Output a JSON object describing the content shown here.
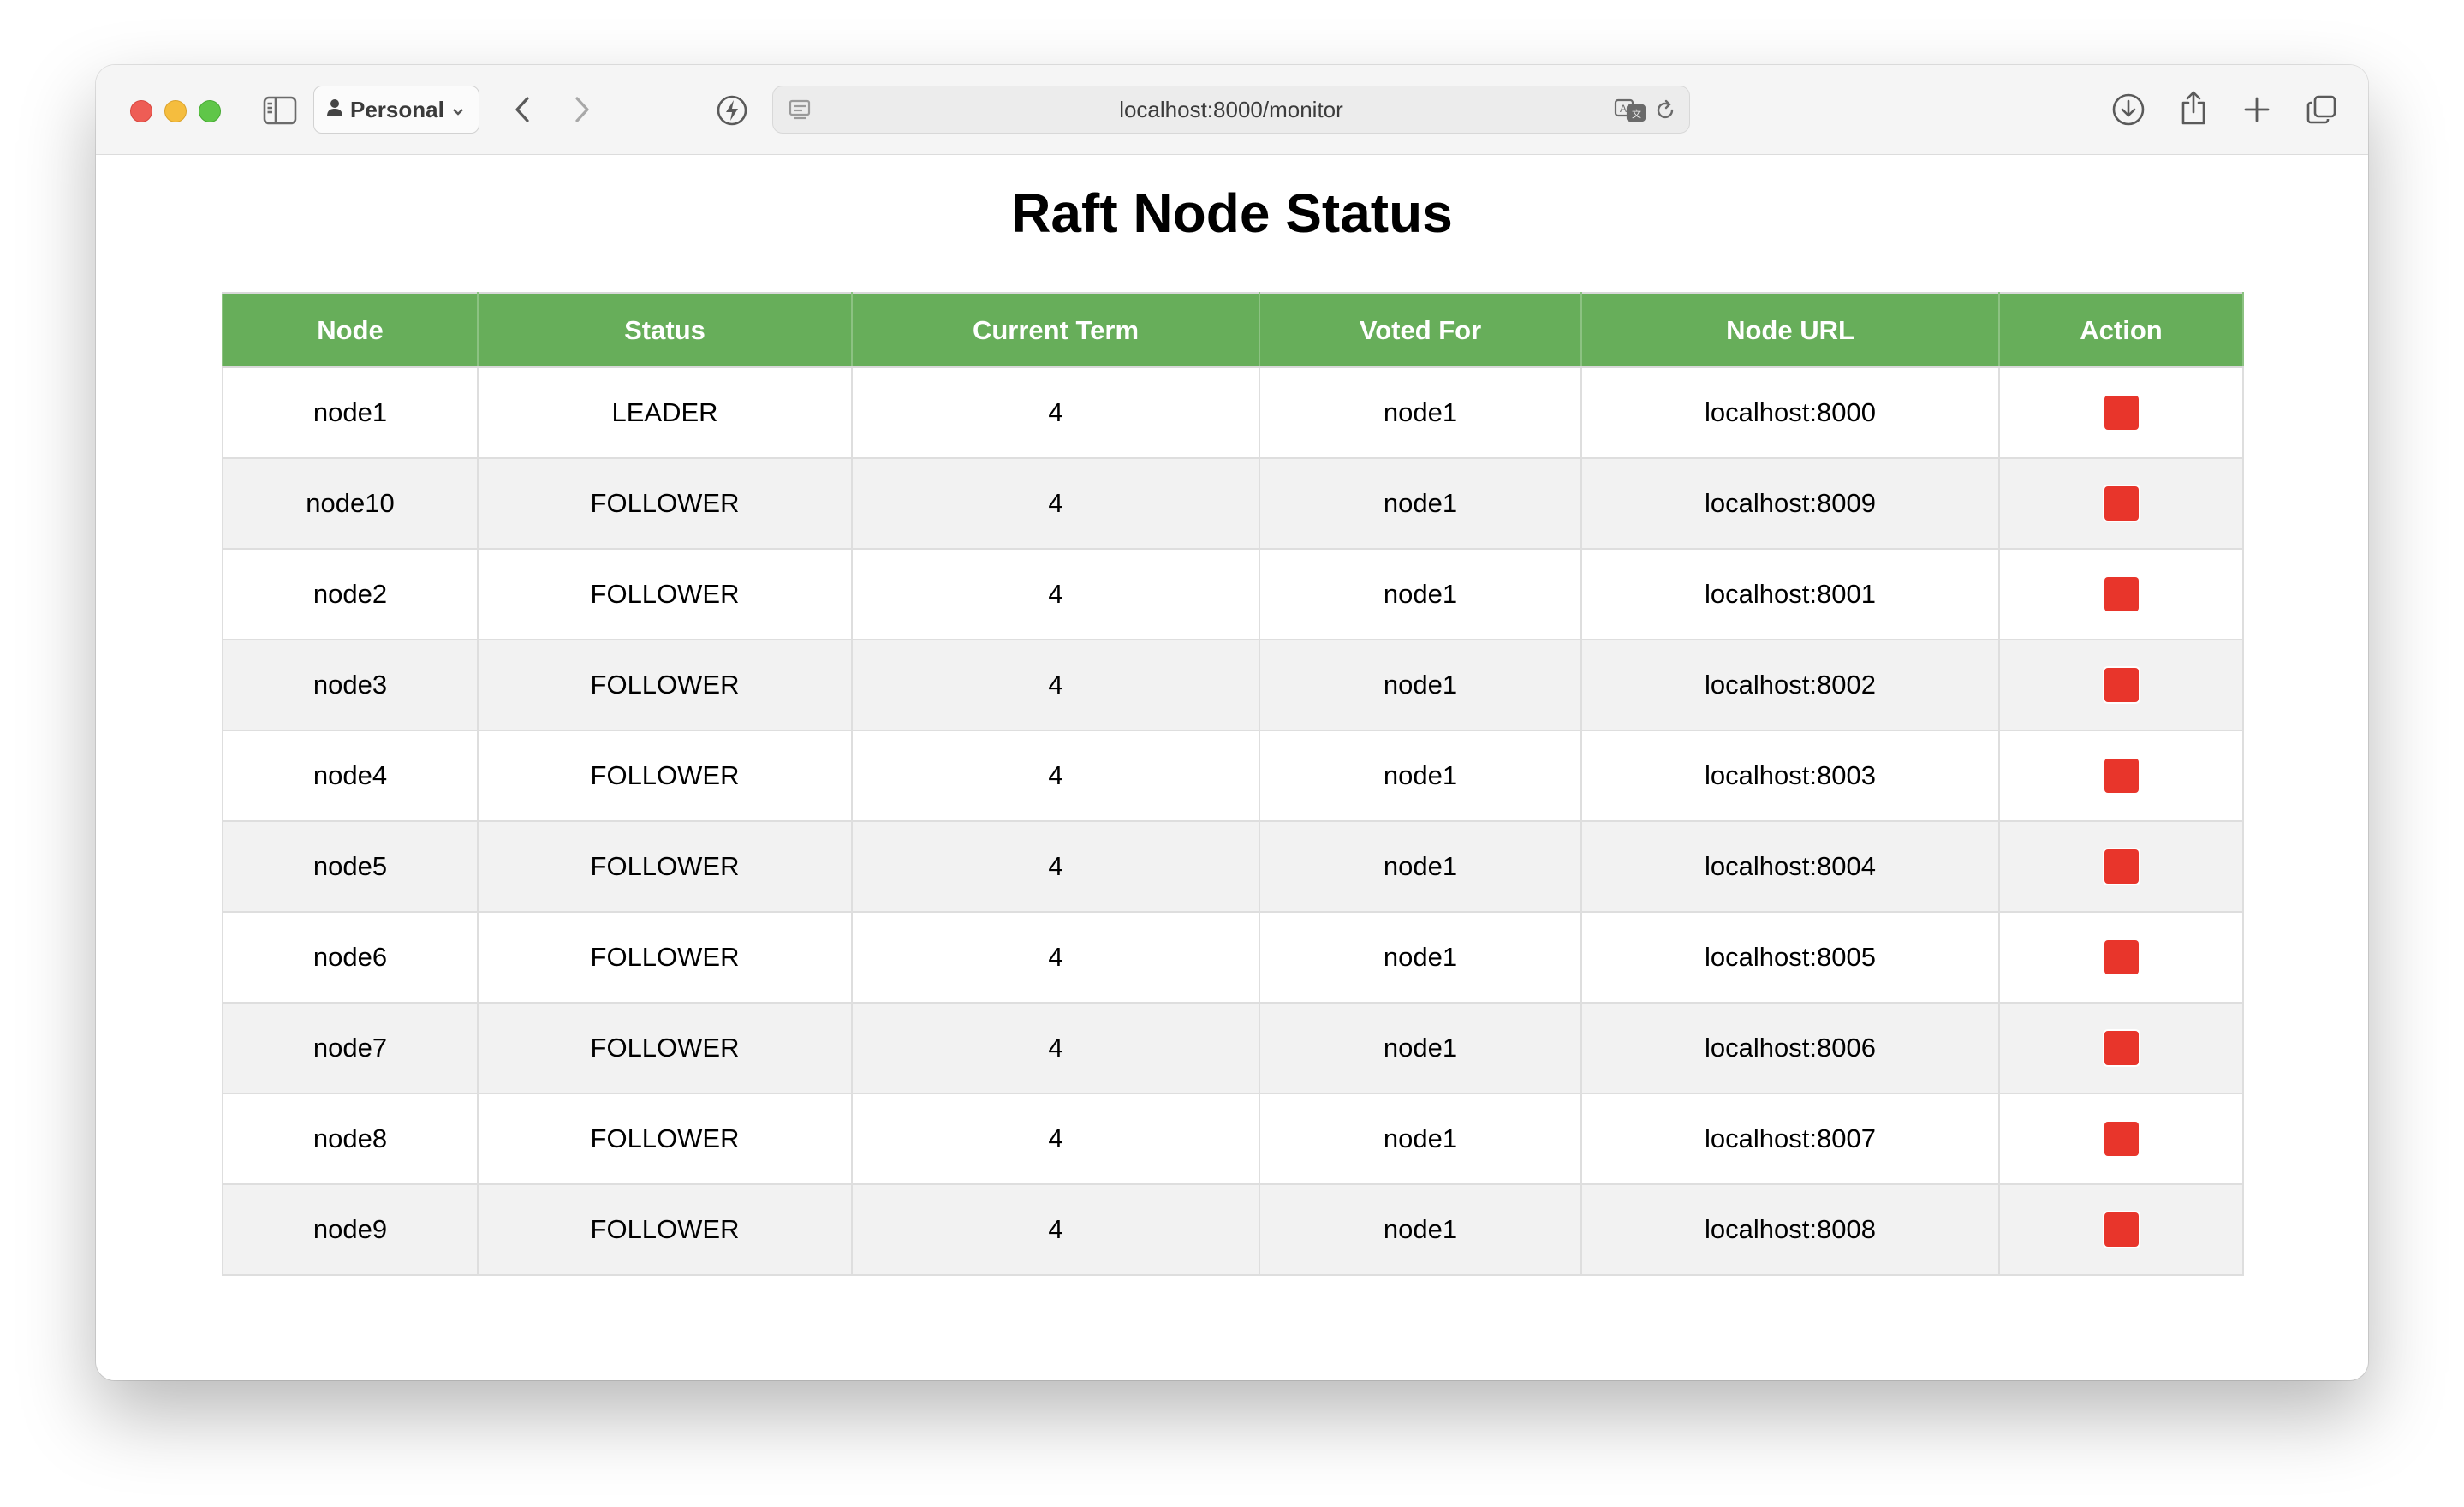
{
  "browser": {
    "profile_label": "Personal",
    "url": "localhost:8000/monitor"
  },
  "page": {
    "title": "Raft Node Status"
  },
  "table": {
    "headers": [
      "Node",
      "Status",
      "Current Term",
      "Voted For",
      "Node URL",
      "Action"
    ],
    "rows": [
      {
        "node": "node1",
        "status": "LEADER",
        "term": "4",
        "voted_for": "node1",
        "url": "localhost:8000"
      },
      {
        "node": "node10",
        "status": "FOLLOWER",
        "term": "4",
        "voted_for": "node1",
        "url": "localhost:8009"
      },
      {
        "node": "node2",
        "status": "FOLLOWER",
        "term": "4",
        "voted_for": "node1",
        "url": "localhost:8001"
      },
      {
        "node": "node3",
        "status": "FOLLOWER",
        "term": "4",
        "voted_for": "node1",
        "url": "localhost:8002"
      },
      {
        "node": "node4",
        "status": "FOLLOWER",
        "term": "4",
        "voted_for": "node1",
        "url": "localhost:8003"
      },
      {
        "node": "node5",
        "status": "FOLLOWER",
        "term": "4",
        "voted_for": "node1",
        "url": "localhost:8004"
      },
      {
        "node": "node6",
        "status": "FOLLOWER",
        "term": "4",
        "voted_for": "node1",
        "url": "localhost:8005"
      },
      {
        "node": "node7",
        "status": "FOLLOWER",
        "term": "4",
        "voted_for": "node1",
        "url": "localhost:8006"
      },
      {
        "node": "node8",
        "status": "FOLLOWER",
        "term": "4",
        "voted_for": "node1",
        "url": "localhost:8007"
      },
      {
        "node": "node9",
        "status": "FOLLOWER",
        "term": "4",
        "voted_for": "node1",
        "url": "localhost:8008"
      }
    ]
  },
  "colors": {
    "header_green": "#67ae5a",
    "stop_red": "#e8352b",
    "alt_row": "#f2f2f2"
  },
  "icons": {
    "action": "stop-square-icon"
  }
}
